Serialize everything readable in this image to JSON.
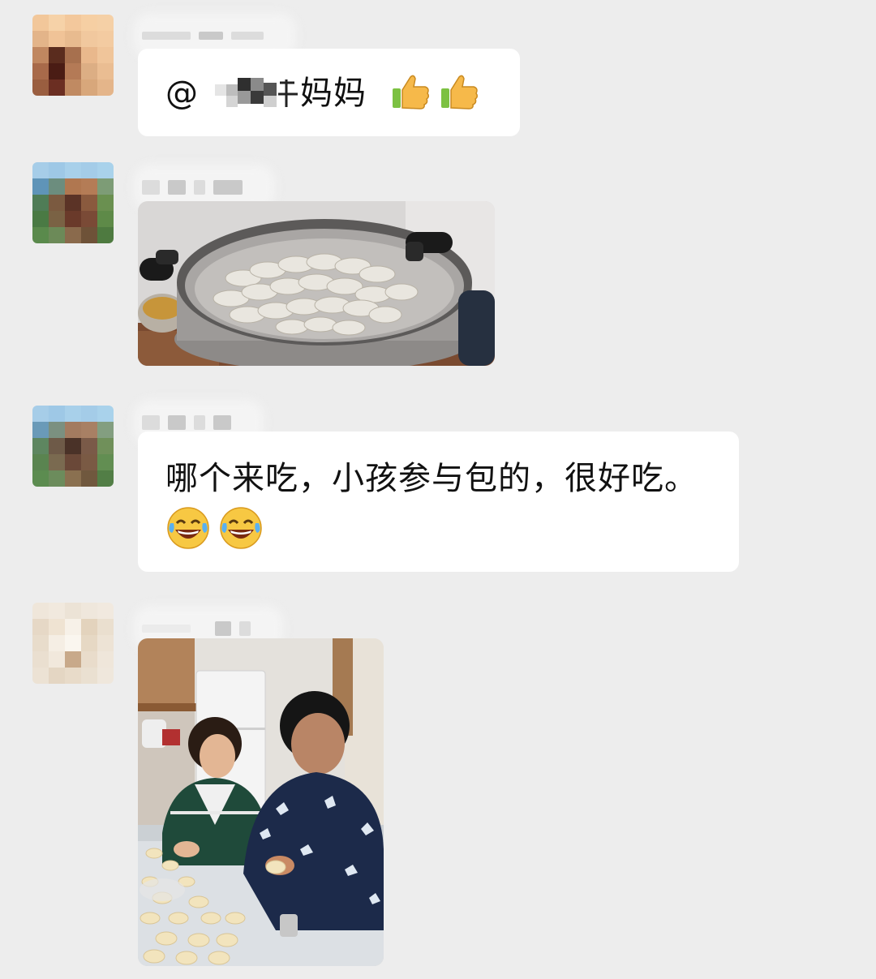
{
  "messages": [
    {
      "type": "text",
      "at_prefix": "@",
      "mention_visible": "妈妈",
      "reactions": [
        "thumbs-up",
        "thumbs-up"
      ]
    },
    {
      "type": "image",
      "image_description_icon": "steamed-dumplings-photo"
    },
    {
      "type": "text",
      "text": "哪个来吃，小孩参与包的，很好吃。",
      "reactions": [
        "laugh-tears",
        "laugh-tears"
      ]
    },
    {
      "type": "image",
      "image_description_icon": "family-making-dumplings-photo"
    }
  ],
  "colors": {
    "background": "#ededed",
    "bubble": "#ffffff",
    "text": "#111111"
  }
}
